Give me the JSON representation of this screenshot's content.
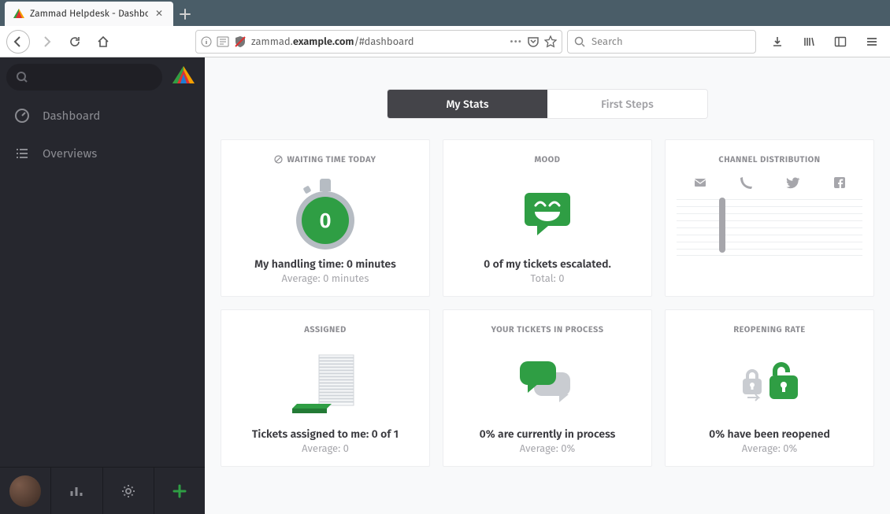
{
  "browser": {
    "tab_title": "Zammad Helpdesk - Dashbo",
    "url_pre": "zammad.",
    "url_host": "example.com",
    "url_path": "/#dashboard",
    "search_placeholder": "Search"
  },
  "sidebar": {
    "nav": [
      {
        "label": "Dashboard",
        "icon": "gauge"
      },
      {
        "label": "Overviews",
        "icon": "list"
      }
    ]
  },
  "tabs": {
    "my_stats": "My Stats",
    "first_steps": "First Steps"
  },
  "cards": {
    "waiting": {
      "title": "WAITING TIME TODAY",
      "value": "0",
      "line1": "My handling time: 0 minutes",
      "line2": "Average: 0 minutes"
    },
    "mood": {
      "title": "MOOD",
      "line1": "0 of my tickets escalated.",
      "line2": "Total: 0"
    },
    "channel": {
      "title": "CHANNEL DISTRIBUTION"
    },
    "assigned": {
      "title": "ASSIGNED",
      "line1": "Tickets assigned to me: 0 of 1",
      "line2": "Average: 0"
    },
    "process": {
      "title": "YOUR TICKETS IN PROCESS",
      "line1": "0% are currently in process",
      "line2": "Average: 0%"
    },
    "reopen": {
      "title": "REOPENING RATE",
      "line1": "0% have been reopened",
      "line2": "Average: 0%"
    }
  }
}
